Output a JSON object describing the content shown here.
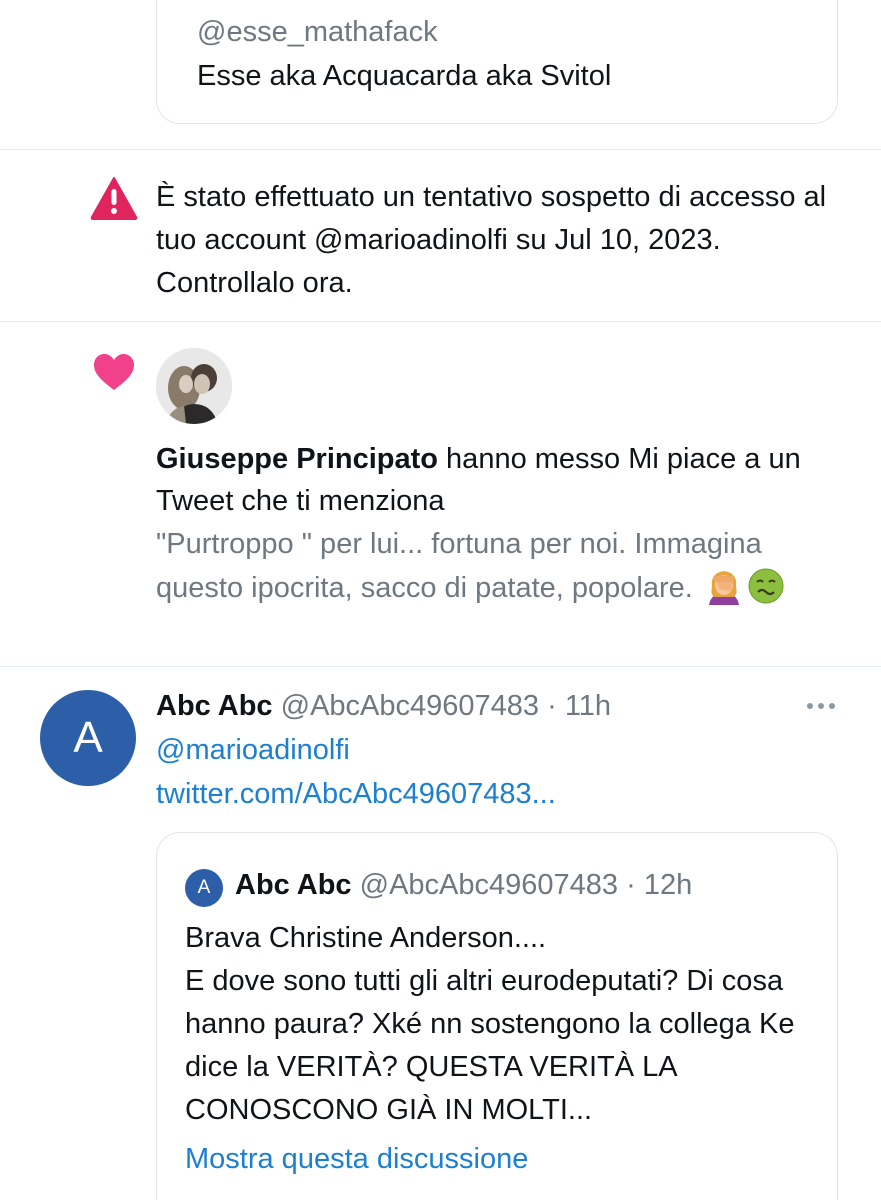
{
  "quoted_top": {
    "handle": "@esse_mathafack",
    "display_name": "Esse aka Acquacarda aka Svitol"
  },
  "security_alert": {
    "icon": "warning-icon",
    "icon_color": "#e0245e",
    "text": "È stato effettuato un tentativo sospetto di accesso al tuo account @marioadinolfi su Jul 10, 2023. Controllalo ora."
  },
  "like_notification": {
    "icon": "heart-icon",
    "icon_color": "#f0418a",
    "liker_name": "Giuseppe Principato",
    "action_text": " hanno messo Mi piace a un Tweet che ti menziona",
    "quote_text": "\"Purtroppo \" per lui... fortuna per noi. Immagina questo ipocrita, sacco di patate, popolare.",
    "emojis": [
      "woman-facepalming-emoji",
      "nauseated-face-emoji"
    ]
  },
  "tweet": {
    "avatar_letter": "A",
    "avatar_color": "#2c5fa8",
    "name": "Abc Abc",
    "handle": "@AbcAbc49607483",
    "separator": " · ",
    "time": "11h",
    "mention": "@marioadinolfi",
    "link": "twitter.com/AbcAbc49607483...",
    "quoted": {
      "avatar_letter": "A",
      "name": "Abc Abc",
      "handle": "@AbcAbc49607483",
      "separator": " · ",
      "time": "12h",
      "text": "Brava Christine Anderson....\nE dove sono tutti gli altri eurodeputati? Di cosa hanno paura? Xké nn sostengono la collega Ke dice la VERITÀ? QUESTA VERITÀ LA CONOSCONO GIÀ IN MOLTI...",
      "show_thread": "Mostra questa discussione"
    }
  },
  "colors": {
    "link": "#1d7fd1",
    "secondary_text": "#6f7880",
    "border": "#e1e6ea"
  }
}
